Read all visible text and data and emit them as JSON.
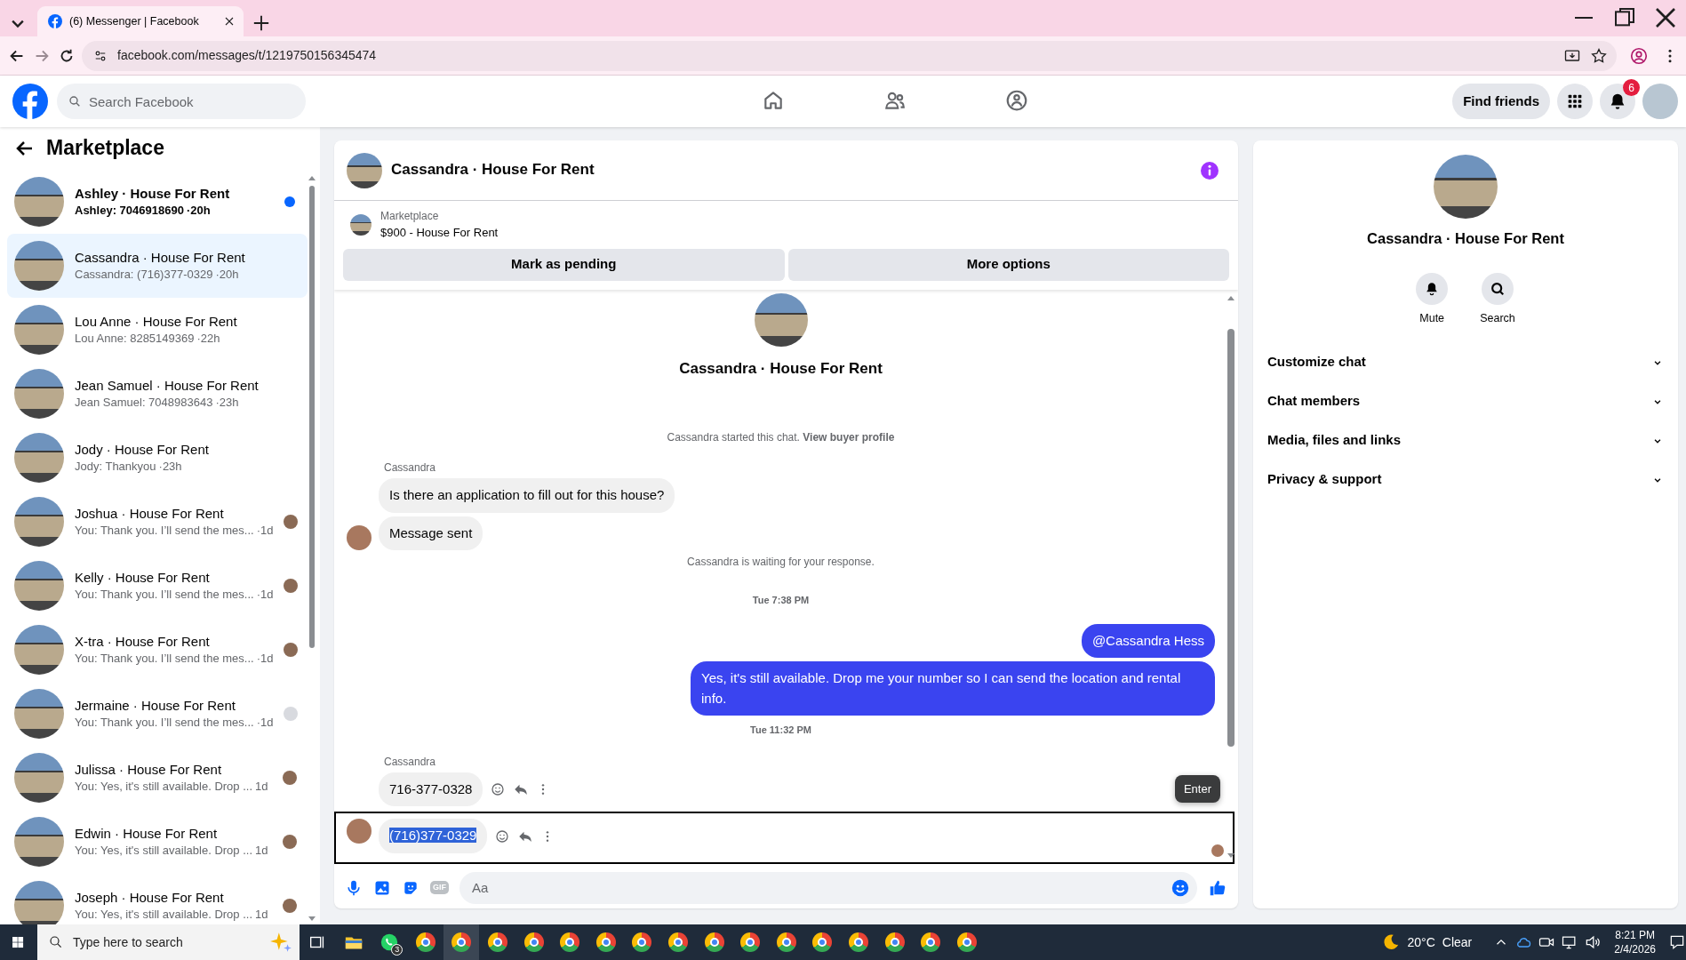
{
  "browser": {
    "tab": {
      "title": "(6) Messenger | Facebook",
      "selected": true
    },
    "url": "facebook.com/messages/t/1219750156345474"
  },
  "topbar": {
    "search": {
      "placeholder": "Search Facebook"
    },
    "nav": [
      {
        "kind": "home",
        "selected": false
      },
      {
        "kind": "friends",
        "selected": false
      },
      {
        "kind": "groups",
        "selected": false
      }
    ],
    "find_friends": "Find friends",
    "notification_count": "6"
  },
  "sidebar": {
    "title": "Marketplace",
    "conversations": [
      {
        "name": "Ashley · House For Rent",
        "preview": "Ashley: 7046918690",
        "time": "·20h",
        "unread": true,
        "selected": false
      },
      {
        "name": "Cassandra · House For Rent",
        "preview": "Cassandra: (716)377-0329",
        "time": "·20h",
        "unread": false,
        "selected": true
      },
      {
        "name": "Lou Anne · House For Rent",
        "preview": "Lou Anne: 8285149369",
        "time": "·22h",
        "unread": false,
        "selected": false
      },
      {
        "name": "Jean Samuel · House For Rent",
        "preview": "Jean Samuel: 7048983643",
        "time": "·23h",
        "unread": false,
        "selected": false
      },
      {
        "name": "Jody · House For Rent",
        "preview": "Jody: Thankyou",
        "time": "·23h",
        "unread": false,
        "selected": false
      },
      {
        "name": "Joshua · House For Rent",
        "preview": "You: Thank you. I’ll send the mes...",
        "time": "·1d",
        "unread": false,
        "selected": false,
        "receipt": {
          "kind": "photo"
        }
      },
      {
        "name": "Kelly · House For Rent",
        "preview": "You: Thank you. I’ll send the mes...",
        "time": "·1d",
        "unread": false,
        "selected": false,
        "receipt": {
          "kind": "photo"
        }
      },
      {
        "name": "X-tra · House For Rent",
        "preview": "You: Thank you. I’ll send the mes...",
        "time": "·1d",
        "unread": false,
        "selected": false,
        "receipt": {
          "kind": "photo"
        }
      },
      {
        "name": "Jermaine · House For Rent",
        "preview": "You: Thank you. I’ll send the mes...",
        "time": "·1d",
        "unread": false,
        "selected": false,
        "receipt": {
          "kind": "silhouette"
        }
      },
      {
        "name": "Julissa · House For Rent",
        "preview": "You: Yes, it's still available. Drop ...",
        "time": "1d",
        "unread": false,
        "selected": false,
        "receipt": {
          "kind": "photo"
        }
      },
      {
        "name": "Edwin · House For Rent",
        "preview": "You: Yes, it's still available. Drop ...",
        "time": "1d",
        "unread": false,
        "selected": false,
        "receipt": {
          "kind": "photo"
        }
      },
      {
        "name": "Joseph · House For Rent",
        "preview": "You: Yes, it's still available. Drop ...",
        "time": "1d",
        "unread": false,
        "selected": false,
        "receipt": {
          "kind": "photo"
        }
      }
    ]
  },
  "chat": {
    "title": "Cassandra · House For Rent",
    "listing": {
      "label": "Marketplace",
      "title": "$900 - House For Rent"
    },
    "actions": [
      "Mark as pending",
      "More options"
    ],
    "messages": [
      {
        "kind": "profile",
        "text": "Cassandra · House For Rent"
      },
      {
        "kind": "notice",
        "text": "Cassandra started this chat.",
        "link": "View buyer profile"
      },
      {
        "kind": "sender",
        "text": "Cassandra"
      },
      {
        "kind": "incoming",
        "text": "Is there an application to fill out for this house?",
        "avatar": false
      },
      {
        "kind": "incoming",
        "text": "Message sent",
        "avatar": true
      },
      {
        "kind": "notice",
        "text": "Cassandra is waiting for your response."
      },
      {
        "kind": "time",
        "text": "Tue 7:38 PM"
      },
      {
        "kind": "outgoing",
        "text": "@Cassandra Hess"
      },
      {
        "kind": "outgoing",
        "text": "Yes, it's still available. Drop me your number so I can send the location and rental info."
      },
      {
        "kind": "time",
        "text": "Tue 11:32 PM"
      },
      {
        "kind": "sender",
        "text": "Cassandra"
      },
      {
        "kind": "incoming",
        "text": "716-377-0328",
        "avatar": false,
        "actions": true
      },
      {
        "kind": "incoming",
        "text": "(716)377-0329",
        "avatar": true,
        "actions": true,
        "focused": true,
        "text_selected": true,
        "seen": true
      }
    ],
    "tooltip": "Enter",
    "composer": {
      "placeholder": "Aa",
      "gif_label": "GIF"
    }
  },
  "details": {
    "name": "Cassandra · House For Rent",
    "actions": [
      {
        "kind": "mute",
        "label": "Mute"
      },
      {
        "kind": "search",
        "label": "Search"
      }
    ],
    "sections": [
      {
        "label": "Customize chat",
        "expanded": false
      },
      {
        "label": "Chat members",
        "expanded": false
      },
      {
        "label": "Media, files and links",
        "expanded": false
      },
      {
        "label": "Privacy & support",
        "expanded": false
      }
    ]
  },
  "taskbar": {
    "search": {
      "placeholder": "Type here to search"
    },
    "apps": [
      {
        "kind": "task_view",
        "selected": false
      },
      {
        "kind": "files",
        "selected": false
      },
      {
        "kind": "whatsapp",
        "selected": false,
        "badge": "3"
      },
      {
        "kind": "chrome",
        "selected": false
      },
      {
        "kind": "chrome",
        "selected": true
      },
      {
        "kind": "chrome",
        "selected": false
      },
      {
        "kind": "chrome",
        "selected": false
      },
      {
        "kind": "chrome",
        "selected": false
      },
      {
        "kind": "chrome",
        "selected": false
      },
      {
        "kind": "chrome",
        "selected": false
      },
      {
        "kind": "chrome",
        "selected": false
      },
      {
        "kind": "chrome",
        "selected": false
      },
      {
        "kind": "chrome",
        "selected": false
      },
      {
        "kind": "chrome",
        "selected": false
      },
      {
        "kind": "chrome",
        "selected": false
      },
      {
        "kind": "chrome",
        "selected": false
      },
      {
        "kind": "chrome",
        "selected": false
      },
      {
        "kind": "chrome",
        "selected": false
      },
      {
        "kind": "chrome",
        "selected": false
      }
    ],
    "weather": {
      "temp": "20°C",
      "condition": "Clear"
    },
    "clock": {
      "time": "8:21 PM",
      "date": "2/4/2026"
    }
  }
}
